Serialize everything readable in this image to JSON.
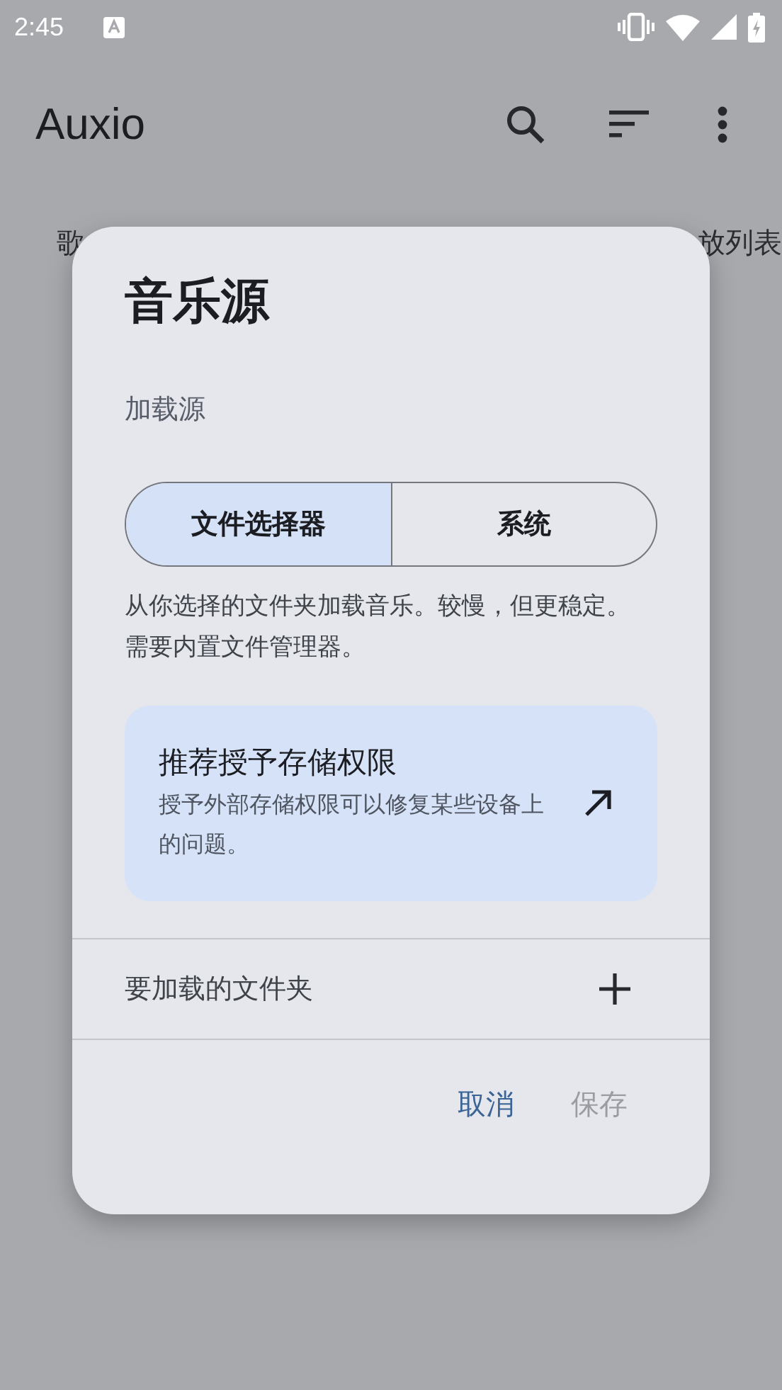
{
  "status_bar": {
    "time": "2:45"
  },
  "app_bar": {
    "title": "Auxio"
  },
  "tabs": [
    {
      "label": "歌"
    },
    {
      "label": "放列表"
    }
  ],
  "dialog": {
    "title": "音乐源",
    "section_label": "加载源",
    "segments": [
      {
        "label": "文件选择器",
        "selected": true
      },
      {
        "label": "系统",
        "selected": false
      }
    ],
    "description": "从你选择的文件夹加载音乐。较慢，但更稳定。需要内置文件管理器。",
    "card": {
      "title": "推荐授予存储权限",
      "body": "授予外部存储权限可以修复某些设备上的问题。"
    },
    "folders_label": "要加载的文件夹",
    "buttons": [
      {
        "label": "取消",
        "disabled": false
      },
      {
        "label": "保存",
        "disabled": true
      }
    ]
  }
}
